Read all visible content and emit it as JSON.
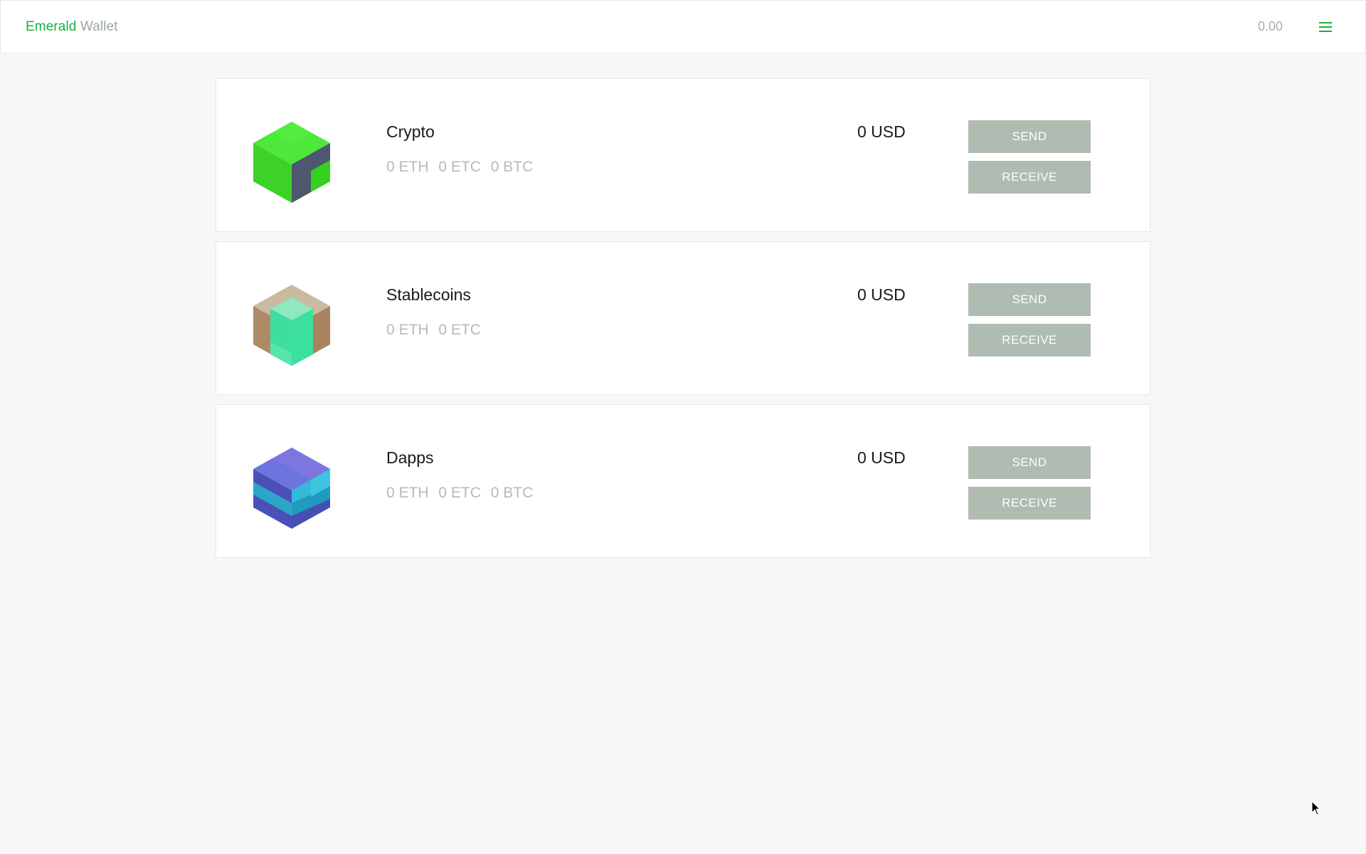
{
  "header": {
    "brand_primary": "Emerald",
    "brand_secondary": "Wallet",
    "total_balance": "0.00",
    "menu_icon": "hamburger-menu-icon",
    "accent_color": "#19b03f"
  },
  "accounts": [
    {
      "name": "Crypto",
      "balances": [
        "0 ETH",
        "0 ETC",
        "0 BTC"
      ],
      "usd": "0 USD",
      "send_label": "SEND",
      "receive_label": "RECEIVE",
      "avatar_icon": "green-cube-icon"
    },
    {
      "name": "Stablecoins",
      "balances": [
        "0 ETH",
        "0 ETC"
      ],
      "usd": "0 USD",
      "send_label": "SEND",
      "receive_label": "RECEIVE",
      "avatar_icon": "tan-teal-cube-icon"
    },
    {
      "name": "Dapps",
      "balances": [
        "0 ETH",
        "0 ETC",
        "0 BTC"
      ],
      "usd": "0 USD",
      "send_label": "SEND",
      "receive_label": "RECEIVE",
      "avatar_icon": "blue-cube-icon"
    }
  ],
  "colors": {
    "button_bg": "#b0bbb2",
    "muted_text": "#b4bcb6",
    "page_bg": "#f6f7f6"
  }
}
